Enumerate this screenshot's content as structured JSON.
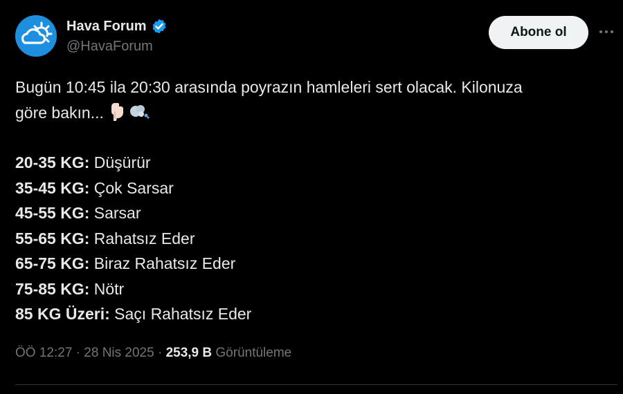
{
  "author": {
    "display_name": "Hava Forum",
    "handle": "@HavaForum",
    "verified": true
  },
  "actions": {
    "follow_label": "Abone ol",
    "more_label": "···"
  },
  "post": {
    "intro_line1": "Bugün 10:45 ila 20:30 arasında poyrazın hamleleri sert olacak. Kilonuza",
    "intro_line2": "göre bakın...",
    "emojis": [
      "pointing-down-emoji",
      "wind-face-emoji"
    ],
    "entries": [
      {
        "key": "20-35 KG:",
        "value": "Düşürür"
      },
      {
        "key": "35-45 KG:",
        "value": "Çok Sarsar"
      },
      {
        "key": "45-55 KG:",
        "value": "Sarsar"
      },
      {
        "key": "55-65 KG:",
        "value": "Rahatsız Eder"
      },
      {
        "key": "65-75 KG:",
        "value": "Biraz Rahatsız Eder"
      },
      {
        "key": "75-85 KG:",
        "value": "Nötr"
      },
      {
        "key": "85 KG Üzeri:",
        "value": "Saçı Rahatsız Eder"
      }
    ]
  },
  "meta": {
    "time": "ÖÖ 12:27",
    "separator": "·",
    "date": "28 Nis 2025",
    "views_count": "253,9 B",
    "views_label": "Görüntüleme"
  },
  "colors": {
    "background": "#000000",
    "text": "#e7e9ea",
    "secondary": "#71767b",
    "accent": "#1d9bf0",
    "follow_bg": "#eff3f4"
  },
  "icons": {
    "avatar": "sun-cloud-logo-icon",
    "verified": "verified-badge-icon",
    "more": "more-icon"
  }
}
